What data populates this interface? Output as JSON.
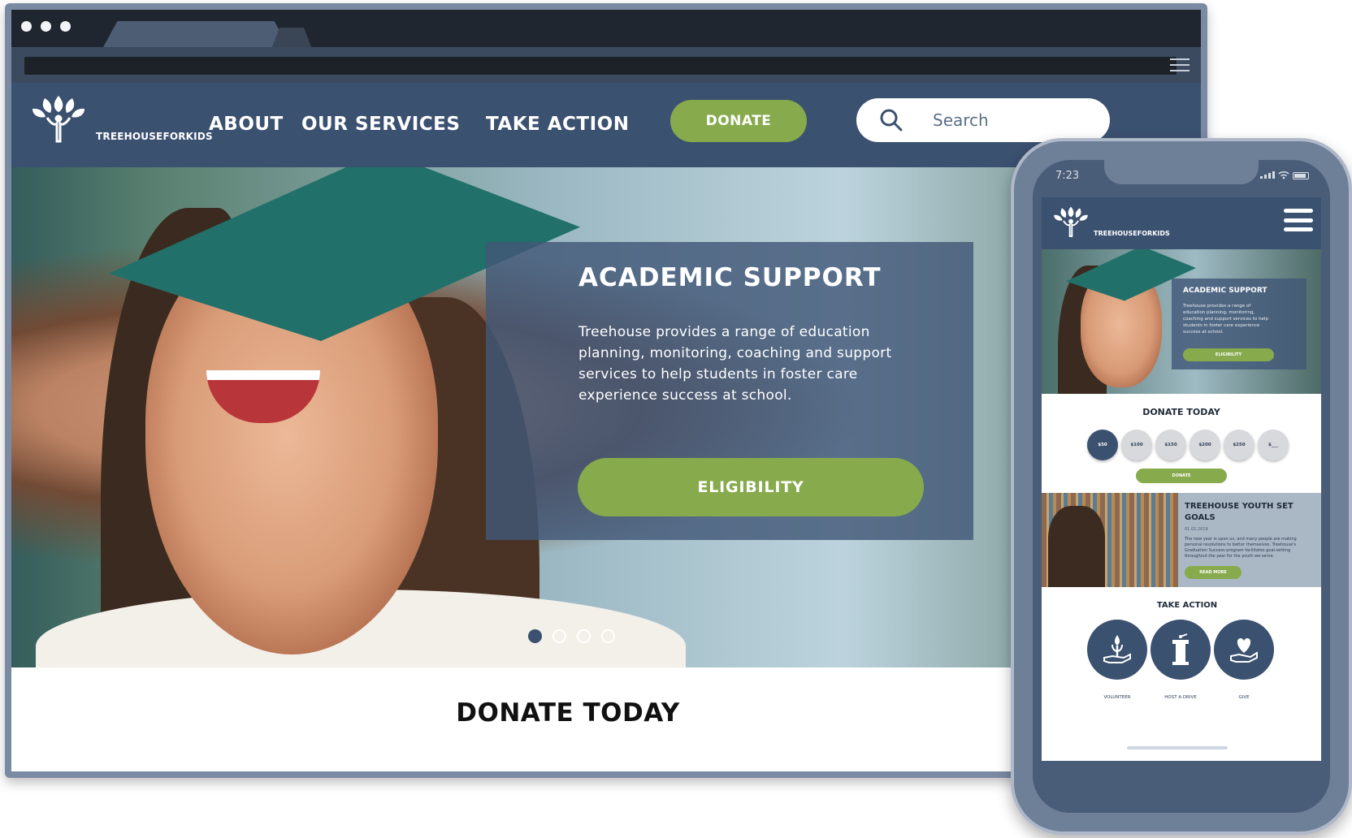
{
  "desktop": {
    "nav": {
      "logo_text": "TREEHOUSEFORKIDS",
      "links": [
        "ABOUT",
        "OUR SERVICES",
        "TAKE ACTION"
      ],
      "donate_label": "DONATE",
      "search_placeholder": "Search"
    },
    "hero": {
      "title": "ACADEMIC SUPPORT",
      "text": "Treehouse provides a range of education planning, monitoring, coaching and support services to help students in foster care experience success at school.",
      "button_label": "ELIGIBILITY",
      "carousel_count": 4,
      "carousel_active": 1
    },
    "section_title": "DONATE TODAY"
  },
  "phone": {
    "time": "7:23",
    "logo_text": "TREEHOUSEFORKIDS",
    "hero": {
      "title": "ACADEMIC SUPPORT",
      "text": "Treehouse provides a range of education planning, monitoring, coaching and support services to help students in foster care experience success at school.",
      "button_label": "ELIGIBILITY"
    },
    "donate": {
      "title": "DONATE TODAY",
      "amounts": [
        "$50",
        "$100",
        "$150",
        "$200",
        "$250",
        "$___"
      ],
      "button_label": "DONATE"
    },
    "blog": {
      "title": "TREEHOUSE YOUTH SET GOALS",
      "date": "01.02.2019",
      "text": "The new year is upon us, and many people are making personal resolutions to better themselves. Treehouse's Graduation Success program facilitates goal-setting throughout the year for the youth we serve.",
      "button_label": "READ MORE"
    },
    "take_action": {
      "title": "TAKE ACTION",
      "items": [
        "VOLUNTEER",
        "HOST A DRIVE",
        "GIVE"
      ]
    }
  },
  "colors": {
    "navy": "#3b5170",
    "green": "#87aa4d",
    "frame": "#4a5d78"
  },
  "icons": [
    "menu-icon",
    "tree-logo-icon",
    "search-icon",
    "hamburger-icon",
    "volunteer-icon",
    "podium-icon",
    "heart-hand-icon"
  ]
}
